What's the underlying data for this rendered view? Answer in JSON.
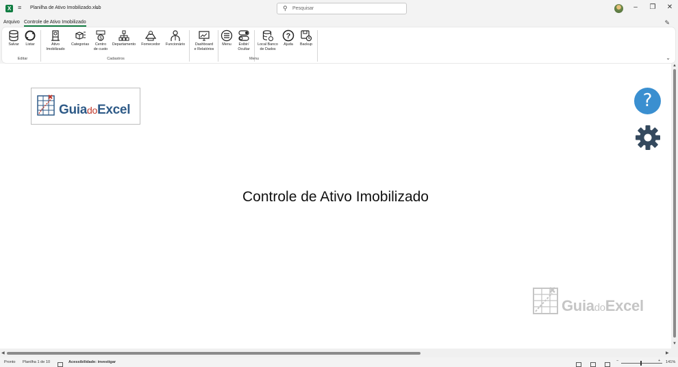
{
  "titlebar": {
    "app_icon": "X",
    "qat_icon": "customize-icon",
    "doc_title": "Planilha de Ativo Imobilizado.xlsb",
    "search_placeholder": "Pesquisar",
    "window_controls": [
      "minimize-icon",
      "restore-icon",
      "close-icon"
    ]
  },
  "tabs": [
    {
      "label": "Arquivo",
      "active": false
    },
    {
      "label": "Controle de Ativo Imobilizado",
      "active": true
    }
  ],
  "ribbon": {
    "buttons": [
      {
        "label": "Salvar",
        "icon": "database-icon"
      },
      {
        "label": "Listar",
        "icon": "refresh-icon"
      },
      {
        "label": "Ativo\nImobilizado",
        "icon": "asset-icon"
      },
      {
        "label": "Categorias",
        "icon": "category-icon"
      },
      {
        "label": "Centro\nde custo",
        "icon": "cost-center-icon"
      },
      {
        "label": "Departamento",
        "icon": "org-chart-icon"
      },
      {
        "label": "Fornecedor",
        "icon": "supplier-icon"
      },
      {
        "label": "Funcionário",
        "icon": "employee-icon"
      },
      {
        "label": "Dashboard\ne Relatórios",
        "icon": "dashboard-icon"
      },
      {
        "label": "Menu",
        "icon": "menu-icon"
      },
      {
        "label": "Exibir/\nOcultar",
        "icon": "toggle-icon"
      },
      {
        "label": "Local Banco\nde Dados",
        "icon": "database-location-icon"
      },
      {
        "label": "Ajuda",
        "icon": "help-icon"
      },
      {
        "label": "Backup",
        "icon": "backup-icon"
      }
    ],
    "groups": [
      "Editar",
      "Cadastros",
      "Menu"
    ]
  },
  "sheet": {
    "logo_text_a": "Guia",
    "logo_text_b": "do",
    "logo_text_c": "Excel",
    "title": "Controle de Ativo Imobilizado",
    "help_glyph": "?",
    "accent_color": "#3a8fd0",
    "gear_color": "#34495e"
  },
  "status": {
    "ready": "Pronto",
    "sheet_info": "Planilha 1 de 10",
    "accessibility": "Acessibilidade: investigar",
    "zoom": "141%"
  }
}
